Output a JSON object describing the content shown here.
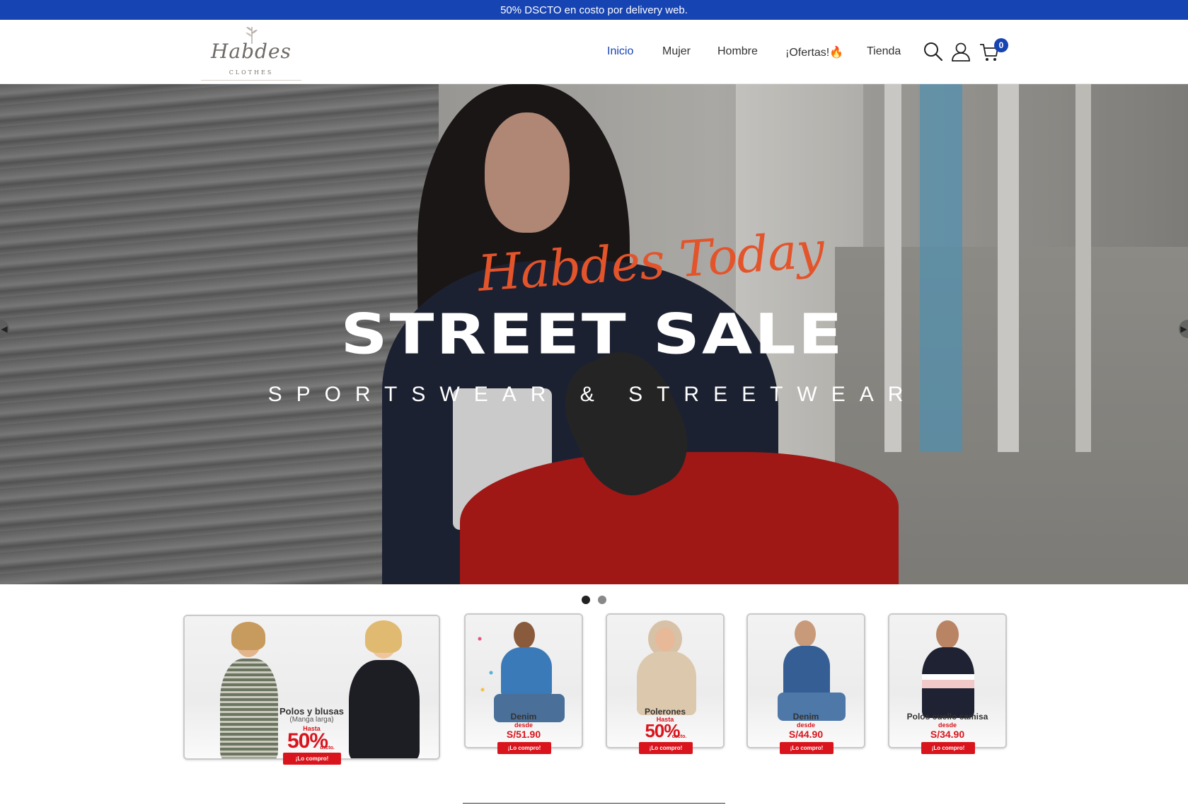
{
  "promo": {
    "text": "50% DSCTO en costo por delivery web."
  },
  "brand": {
    "name": "Habdes",
    "tagline": "CLOTHES"
  },
  "nav": {
    "items": [
      {
        "label": "Inicio",
        "active": true
      },
      {
        "label": "Mujer",
        "active": false
      },
      {
        "label": "Hombre",
        "active": false
      },
      {
        "label": "¡Ofertas!🔥",
        "active": false
      },
      {
        "label": "Tienda",
        "active": false
      }
    ]
  },
  "header_icons": {
    "search": "search-icon",
    "account": "user-icon",
    "cart": "cart-icon",
    "cart_count": "0"
  },
  "hero": {
    "script_text": "Habdes Today",
    "title": "STREET SALE",
    "subtitle": "SPORTSWEAR & STREETWEAR",
    "slides_total": 2,
    "active_slide": 1
  },
  "categories": [
    {
      "title": "Polos y blusas",
      "note": "(Manga larga)",
      "small": "Hasta",
      "big": "50%",
      "suffix": "dscto.",
      "button": "¡Lo compro!"
    },
    {
      "title": "Denim",
      "small": "desde",
      "price": "S/51.90",
      "button": "¡Lo compro!"
    },
    {
      "title": "Polerones",
      "small": "Hasta",
      "big": "50%",
      "suffix": "dscto.",
      "button": "¡Lo compro!"
    },
    {
      "title": "Denim",
      "small": "desde",
      "price": "S/44.90",
      "button": "¡Lo compro!"
    },
    {
      "title": "Polos cuello camisa",
      "small": "desde",
      "price": "S/34.90",
      "button": "¡Lo compro!"
    }
  ],
  "colors": {
    "brand_blue": "#1744b3",
    "sale_red": "#d9141c",
    "script_orange": "#e3542b"
  }
}
